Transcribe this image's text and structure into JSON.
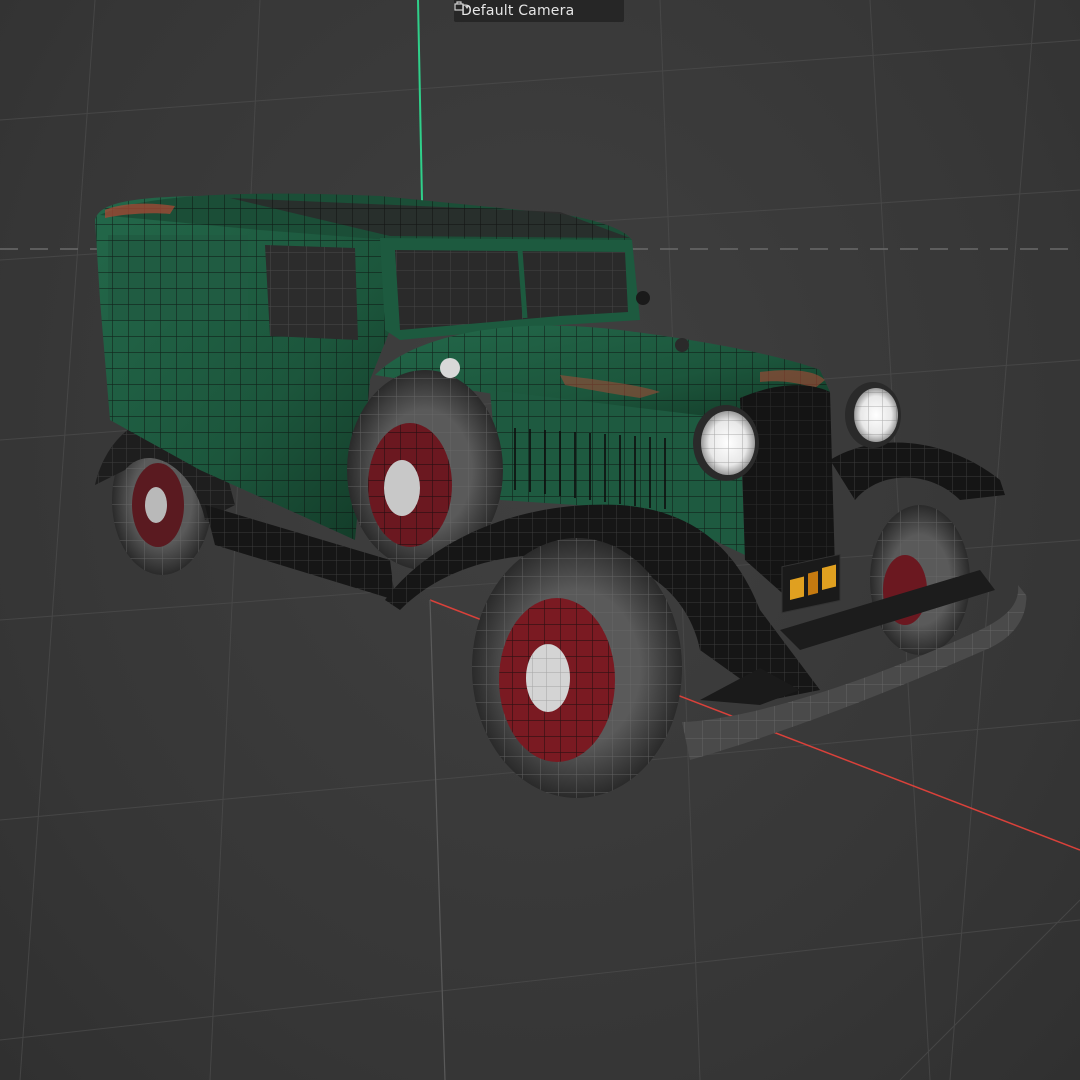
{
  "viewport": {
    "camera_label": "Default Camera",
    "camera_icon": "camera-switch-icon",
    "background_color": "#3a3a3a",
    "y_axis_color": "#2fd08a",
    "x_axis_color": "#d9413a",
    "model_body_color": "#1f5a3f",
    "wheel_rim_color": "#8a1c24"
  }
}
